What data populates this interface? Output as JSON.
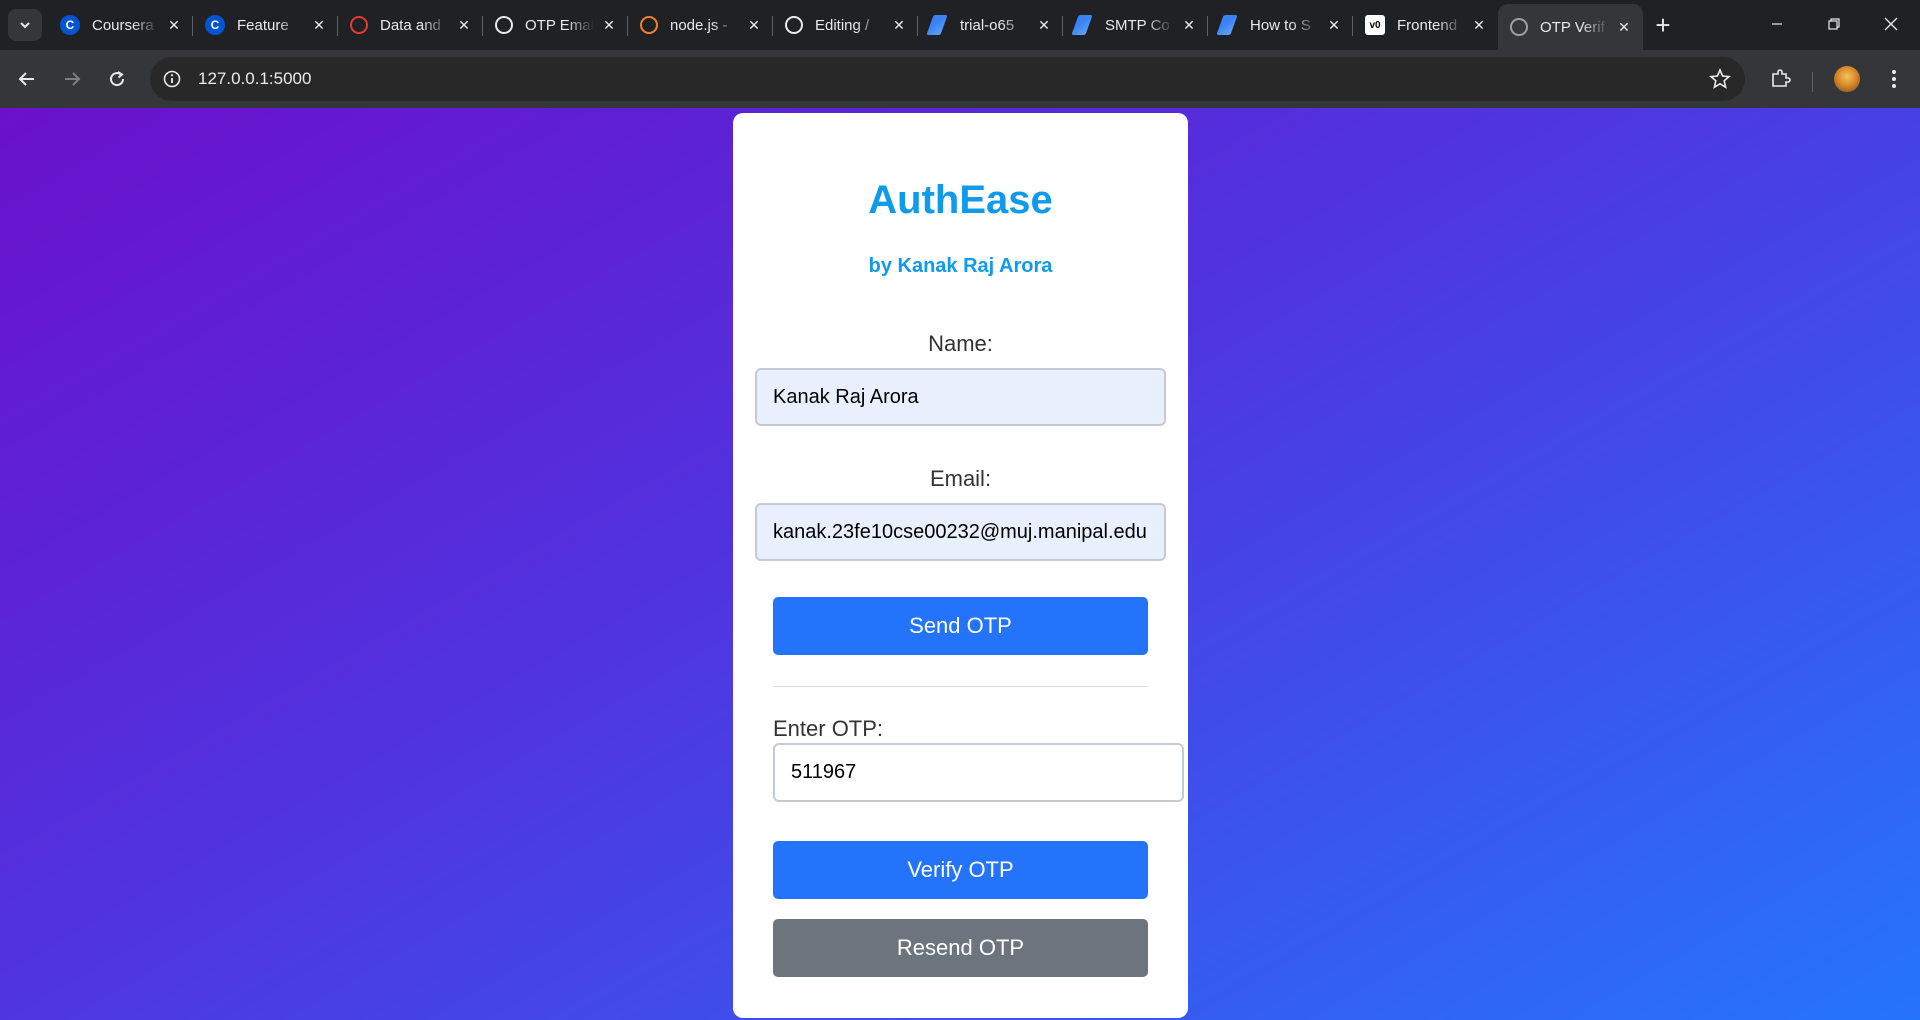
{
  "browser": {
    "tabs": [
      {
        "title": "Coursera",
        "favicon": "coursera-icon",
        "color": "#0056d2"
      },
      {
        "title": "Feature",
        "favicon": "coursera-icon",
        "color": "#0056d2"
      },
      {
        "title": "Data and",
        "favicon": "signal-icon",
        "color": "#e53935"
      },
      {
        "title": "OTP Email",
        "favicon": "openai-icon",
        "color": "#e8eaed"
      },
      {
        "title": "node.js -",
        "favicon": "stackoverflow-icon",
        "color": "#f48024"
      },
      {
        "title": "Editing /",
        "favicon": "github-icon",
        "color": "#e8eaed"
      },
      {
        "title": "trial-o65",
        "favicon": "codeium-icon",
        "color": "#3b82f6"
      },
      {
        "title": "SMTP Co",
        "favicon": "codeium-icon",
        "color": "#3b82f6"
      },
      {
        "title": "How to S",
        "favicon": "codeium-icon",
        "color": "#3b82f6"
      },
      {
        "title": "Frontend",
        "favicon": "v0-icon",
        "color": "#ffffff"
      },
      {
        "title": "OTP Verif",
        "favicon": "globe-icon",
        "color": "#9aa0a6",
        "active": true
      }
    ],
    "url": "127.0.0.1:5000"
  },
  "app": {
    "brand": "AuthEase",
    "byline": "by Kanak Raj Arora",
    "name_label": "Name:",
    "name_value": "Kanak Raj Arora",
    "email_label": "Email:",
    "email_value": "kanak.23fe10cse00232@muj.manipal.edu",
    "send_otp": "Send OTP",
    "otp_label": "Enter OTP:",
    "otp_value": "511967",
    "verify_otp": "Verify OTP",
    "resend_otp": "Resend OTP"
  },
  "colors": {
    "brand": "#0f9bea",
    "primary_button": "#2474fb",
    "secondary_button": "#6c757d",
    "gradient_start": "#6a11cb",
    "gradient_end": "#2575fc"
  }
}
